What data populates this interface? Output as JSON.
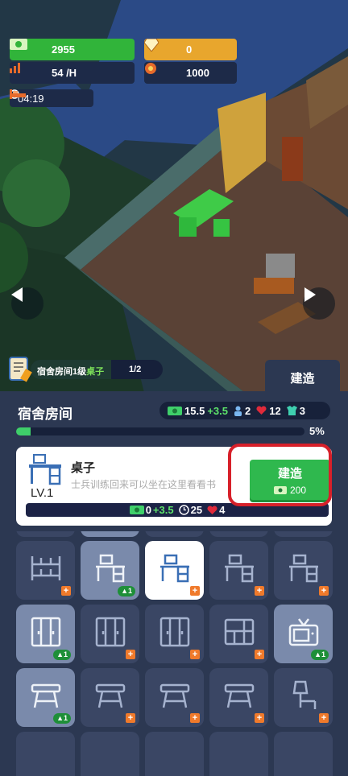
{
  "hud": {
    "cash": "2955",
    "gems": "0",
    "income": "54 /H",
    "power": "1000",
    "timer": "04:19"
  },
  "quest": {
    "text": "宿舍房间1级",
    "highlight": "桌子",
    "count": "1/2"
  },
  "tab_label": "建造",
  "room": {
    "title": "宿舍房间",
    "stats": {
      "cash": "15.5",
      "cash_bonus": "+3.5",
      "soldiers": "2",
      "hearts": "12",
      "armor": "3"
    },
    "progress_label": "5%",
    "progress": 0.05
  },
  "item": {
    "name": "桌子",
    "level": "LV.1",
    "description": "士兵训练回来可以坐在这里看看书",
    "stats": {
      "cash": "0",
      "cash_bonus": "+3.5",
      "time": "25",
      "hearts": "4"
    },
    "build_label": "建造",
    "build_cost": "200"
  },
  "grid": [
    {
      "icon": "bunk-bed-icon",
      "state": "normal",
      "badge": "+"
    },
    {
      "icon": "desk-icon",
      "state": "lit",
      "badge": "▲1"
    },
    {
      "icon": "desk-icon",
      "state": "selected",
      "badge": "+"
    },
    {
      "icon": "desk-icon",
      "state": "normal",
      "badge": "+"
    },
    {
      "icon": "desk-icon",
      "state": "normal",
      "badge": "+"
    },
    {
      "icon": "wardrobe-icon",
      "state": "lit",
      "badge": "▲1"
    },
    {
      "icon": "wardrobe-icon",
      "state": "normal",
      "badge": "+"
    },
    {
      "icon": "wardrobe-icon",
      "state": "normal",
      "badge": "+"
    },
    {
      "icon": "cabinet-icon",
      "state": "normal",
      "badge": "+"
    },
    {
      "icon": "tv-icon",
      "state": "lit",
      "badge": "▲1"
    },
    {
      "icon": "stool-icon",
      "state": "lit",
      "badge": "▲1"
    },
    {
      "icon": "stool-icon",
      "state": "normal",
      "badge": "+"
    },
    {
      "icon": "stool-icon",
      "state": "normal",
      "badge": "+"
    },
    {
      "icon": "stool-icon",
      "state": "normal",
      "badge": "+"
    },
    {
      "icon": "lamp-icon",
      "state": "normal",
      "badge": "+"
    }
  ],
  "colors": {
    "green": "#31b43a",
    "gold": "#e8a62d",
    "panel": "#2c3852",
    "alert": "#d7202a"
  }
}
